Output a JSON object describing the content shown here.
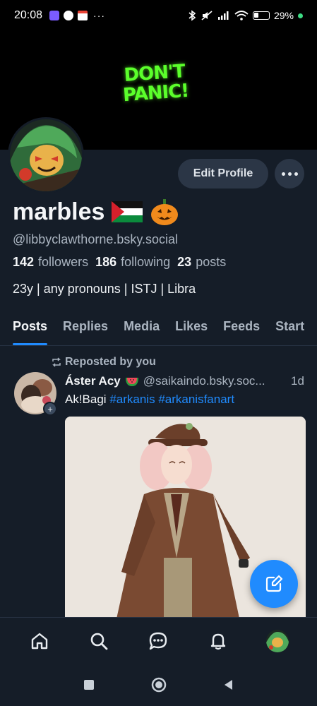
{
  "status_bar": {
    "time": "20:08",
    "more": "···",
    "battery": "29%",
    "icons": [
      "notification-app-icon",
      "google-icon",
      "gmail-icon",
      "bluetooth-icon",
      "mute-icon",
      "signal-icon",
      "wifi-icon",
      "battery-icon"
    ]
  },
  "banner": {
    "line1": "DON'T",
    "line2": "PANIC!",
    "accent": "#5bff2b"
  },
  "profile": {
    "display_name": "marbles",
    "handle": "@libbyclawthorne.bsky.social",
    "followers_count": "142",
    "followers_label": "followers",
    "following_count": "186",
    "following_label": "following",
    "posts_count": "23",
    "posts_label": "posts",
    "bio": "23y | any pronouns | ISTJ | Libra",
    "edit_label": "Edit Profile"
  },
  "tabs": [
    {
      "label": "Posts",
      "active": true
    },
    {
      "label": "Replies"
    },
    {
      "label": "Media"
    },
    {
      "label": "Likes"
    },
    {
      "label": "Feeds"
    },
    {
      "label": "Start"
    }
  ],
  "post": {
    "repost_label": "Reposted by you",
    "author": "Áster Acy",
    "handle": "@saikaindo.bsky.soc...",
    "time": "1d",
    "text_prefix": "Ak!Bagi",
    "hashtag1": "#arkanis",
    "hashtag2": "#arkanisfanart"
  },
  "colors": {
    "background": "#151d28",
    "accent": "#208bfe",
    "button_bg": "#2b3646",
    "muted_text": "#aab4c0"
  }
}
